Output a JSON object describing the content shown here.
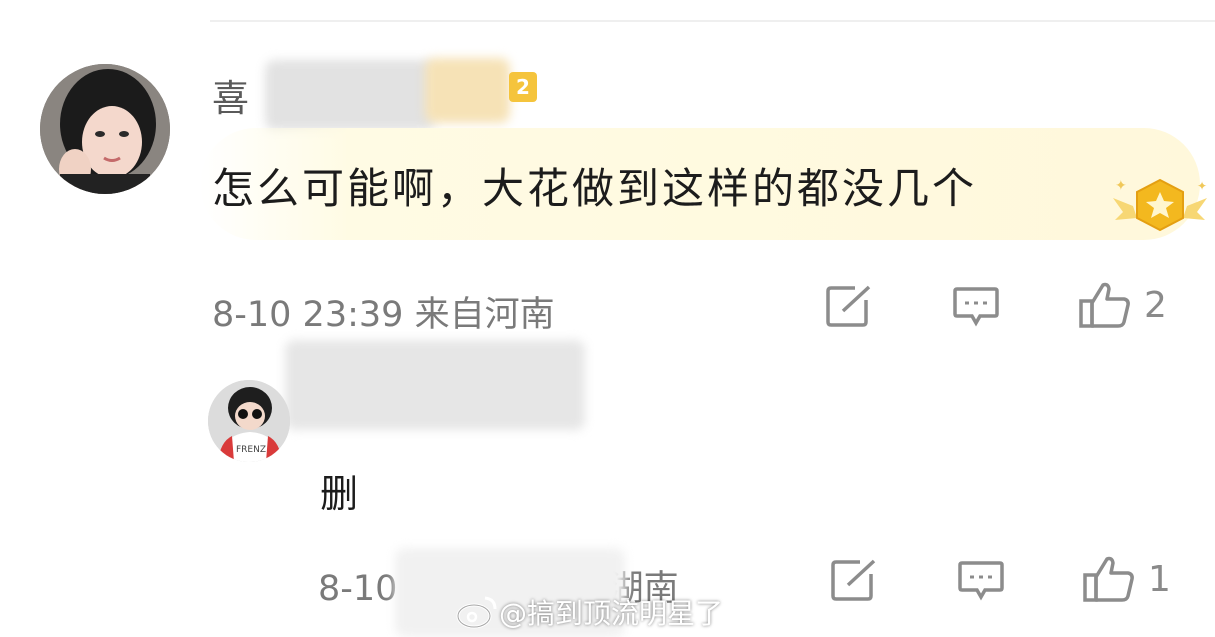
{
  "comment": {
    "username_visible": "喜",
    "level": "2",
    "text": "怎么可能啊，大花做到这样的都没几个",
    "timestamp": "8-10 23:39",
    "location": "来自河南",
    "likes": "2",
    "icons": [
      "share-icon",
      "reply-comment-icon",
      "thumbs-up-icon",
      "medal-icon"
    ]
  },
  "reply": {
    "text": "删",
    "timestamp_visible": "8-10",
    "location_visible": "湖南",
    "likes": "1",
    "avatar_shirt_text": "FRENZ"
  },
  "watermark": {
    "text": "@搞到顶流明星了",
    "icon": "weibo-logo-icon"
  },
  "colors": {
    "highlight": "#fff8db",
    "badge": "#f5c43c",
    "meta": "#7a7a7a",
    "icon": "#8c8c8c"
  }
}
